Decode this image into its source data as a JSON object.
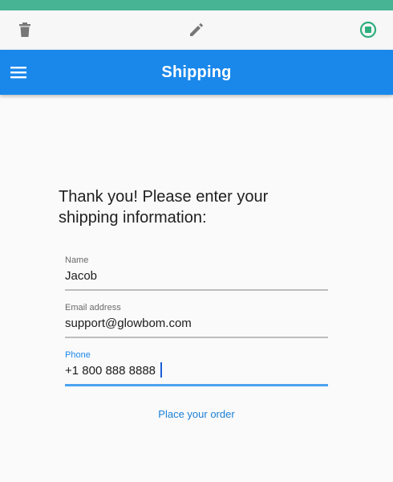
{
  "colors": {
    "top_strip": "#47b493",
    "app_bar": "#1a88eb",
    "background": "#fafafa",
    "active_accent": "#1a88eb",
    "stop_icon": "#2fae7e"
  },
  "toolbar": {
    "icons": [
      "trash-icon",
      "pencil-icon",
      "stop-recording-icon"
    ]
  },
  "app_bar": {
    "title": "Shipping",
    "menu_icon": "hamburger-menu-icon"
  },
  "form": {
    "heading": "Thank you! Please enter your shipping information:",
    "fields": [
      {
        "label": "Name",
        "value": "Jacob"
      },
      {
        "label": "Email address",
        "value": "support@glowbom.com"
      },
      {
        "label": "Phone",
        "value": "+1 800 888 8888",
        "focused": true
      }
    ],
    "submit_label": "Place your order"
  }
}
